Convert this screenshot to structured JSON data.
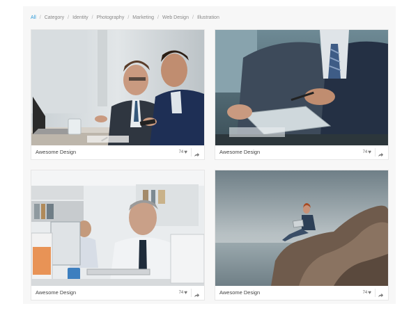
{
  "filters": [
    "All",
    "Category",
    "Identity",
    "Photography",
    "Marketing",
    "Web Design",
    "Illustration"
  ],
  "filter_separator": "/",
  "active_filter": "All",
  "accent_color": "#2d9bd8",
  "cards": [
    {
      "title": "Awesome Design",
      "likes": "74",
      "like_icon": "heart-icon",
      "share_icon": "share-icon"
    },
    {
      "title": "Awesome Design",
      "likes": "74",
      "like_icon": "heart-icon",
      "share_icon": "share-icon"
    },
    {
      "title": "Awesome Design",
      "likes": "74",
      "like_icon": "heart-icon",
      "share_icon": "share-icon"
    },
    {
      "title": "Awesome Design",
      "likes": "74",
      "like_icon": "heart-icon",
      "share_icon": "share-icon"
    }
  ]
}
